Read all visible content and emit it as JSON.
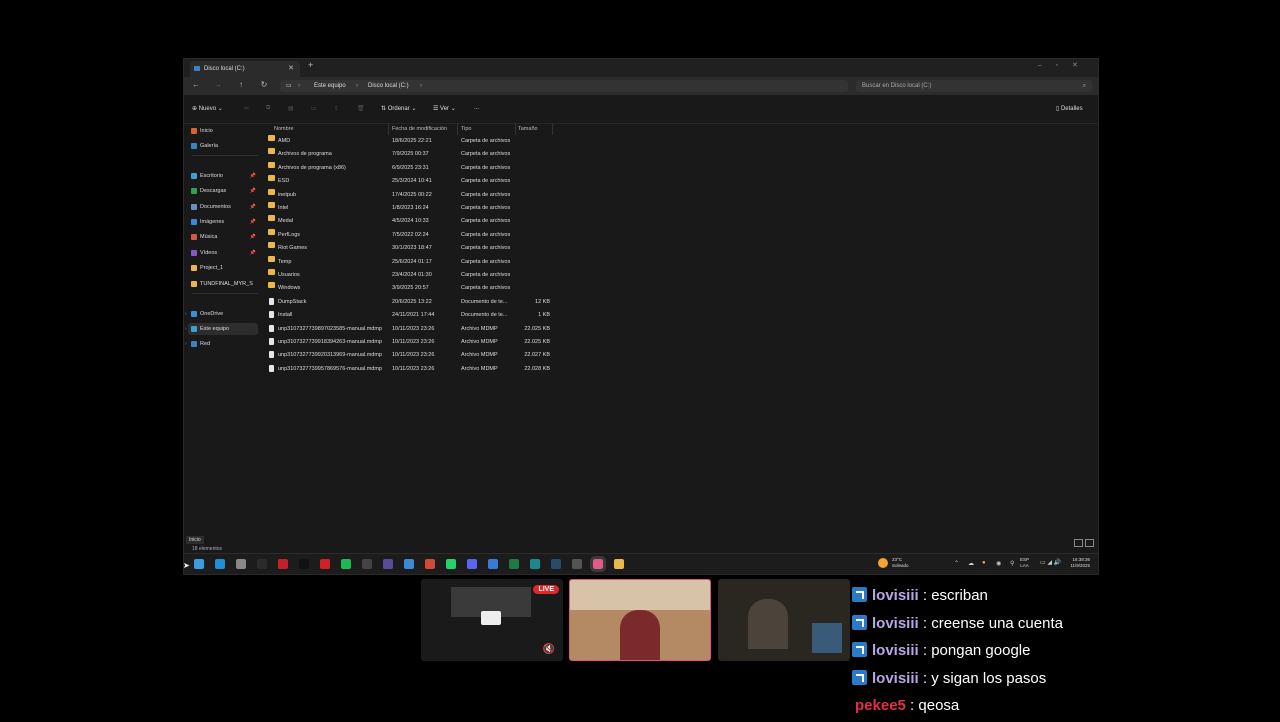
{
  "explorer": {
    "tab_title": "Disco local (C:)",
    "breadcrumb": [
      "Este equipo",
      "Disco local (C:)"
    ],
    "search_placeholder": "Buscar en Disco local (C:)",
    "commands": {
      "new": "Nuevo",
      "sort": "Ordenar",
      "view": "Ver",
      "more": "...",
      "details": "Detalles"
    },
    "sidebar": [
      {
        "label": "Inicio",
        "icon": "home-icon",
        "color": "#d9632a"
      },
      {
        "label": "Galería",
        "icon": "gallery-icon",
        "color": "#3b82c4"
      },
      {
        "label": "Escritorio",
        "icon": "desktop-icon",
        "color": "#3aa0d8",
        "pinned": true
      },
      {
        "label": "Descargas",
        "icon": "download-icon",
        "color": "#2f9e5a",
        "pinned": true
      },
      {
        "label": "Documentos",
        "icon": "documents-icon",
        "color": "#6a8fbf",
        "pinned": true
      },
      {
        "label": "Imágenes",
        "icon": "pictures-icon",
        "color": "#3a8ad6",
        "pinned": true
      },
      {
        "label": "Música",
        "icon": "music-icon",
        "color": "#d05a4a",
        "pinned": true
      },
      {
        "label": "Vídeos",
        "icon": "videos-icon",
        "color": "#8a55c9",
        "pinned": true
      },
      {
        "label": "Project_1",
        "icon": "folder-icon",
        "color": "#e8b94a"
      },
      {
        "label": "TUNDFINAL_MYR_S",
        "icon": "folder-icon",
        "color": "#e8b94a"
      },
      {
        "label": "OneDrive",
        "icon": "onedrive-icon",
        "color": "#3b8fd9"
      },
      {
        "label": "Este equipo",
        "icon": "pc-icon",
        "color": "#3aa0d8",
        "selected": true
      },
      {
        "label": "Red",
        "icon": "network-icon",
        "color": "#3b82c4"
      }
    ],
    "columns": [
      "Nombre",
      "Fecha de modificación",
      "Tipo",
      "Tamaño"
    ],
    "files": [
      {
        "name": "AMD",
        "date": "18/6/2025 22:21",
        "type": "Carpeta de archivos",
        "size": "",
        "kind": "folder"
      },
      {
        "name": "Archivos de programa",
        "date": "7/9/2025 00:37",
        "type": "Carpeta de archivos",
        "size": "",
        "kind": "folder"
      },
      {
        "name": "Archivos de programa (x86)",
        "date": "6/9/2025 23:31",
        "type": "Carpeta de archivos",
        "size": "",
        "kind": "folder"
      },
      {
        "name": "ESD",
        "date": "25/3/2024 10:41",
        "type": "Carpeta de archivos",
        "size": "",
        "kind": "folder"
      },
      {
        "name": "inetpub",
        "date": "17/4/2025 00:22",
        "type": "Carpeta de archivos",
        "size": "",
        "kind": "folder"
      },
      {
        "name": "Intel",
        "date": "1/8/2023 16:24",
        "type": "Carpeta de archivos",
        "size": "",
        "kind": "folder"
      },
      {
        "name": "Medal",
        "date": "4/5/2024 10:33",
        "type": "Carpeta de archivos",
        "size": "",
        "kind": "folder"
      },
      {
        "name": "PerfLogs",
        "date": "7/5/2022 02:24",
        "type": "Carpeta de archivos",
        "size": "",
        "kind": "folder"
      },
      {
        "name": "Riot Games",
        "date": "30/1/2023 18:47",
        "type": "Carpeta de archivos",
        "size": "",
        "kind": "folder"
      },
      {
        "name": "Temp",
        "date": "25/6/2024 01:17",
        "type": "Carpeta de archivos",
        "size": "",
        "kind": "folder"
      },
      {
        "name": "Usuarios",
        "date": "23/4/2024 01:30",
        "type": "Carpeta de archivos",
        "size": "",
        "kind": "folder"
      },
      {
        "name": "Windows",
        "date": "3/9/2025 20:57",
        "type": "Carpeta de archivos",
        "size": "",
        "kind": "folder"
      },
      {
        "name": "DumpStack",
        "date": "20/6/2025 13:22",
        "type": "Documento de te...",
        "size": "12 KB",
        "kind": "file"
      },
      {
        "name": "Install",
        "date": "24/11/2021 17:44",
        "type": "Documento de te...",
        "size": "1 KB",
        "kind": "file"
      },
      {
        "name": "unp3107327739897023585-manual.mdmp",
        "date": "10/11/2023 23:26",
        "type": "Archivo MDMP",
        "size": "22.025 KB",
        "kind": "file"
      },
      {
        "name": "unp3107327739918394263-manual.mdmp",
        "date": "10/11/2023 23:26",
        "type": "Archivo MDMP",
        "size": "22.025 KB",
        "kind": "file"
      },
      {
        "name": "unp3107327739920313969-manual.mdmp",
        "date": "10/11/2023 23:26",
        "type": "Archivo MDMP",
        "size": "22.027 KB",
        "kind": "file"
      },
      {
        "name": "unp3107327739957869576-manual.mdmp",
        "date": "10/11/2023 23:26",
        "type": "Archivo MDMP",
        "size": "22.028 KB",
        "kind": "file"
      }
    ],
    "status_text": "18 elementos",
    "start_tooltip": "Inicio"
  },
  "taskbar": {
    "weather_temp": "23°C",
    "weather_desc": "Soleado",
    "lang_top": "ESP",
    "lang_bottom": "LAA",
    "time": "16:38:36",
    "date": "11/9/2025",
    "icons": [
      {
        "name": "start-icon",
        "color": "#3a9be0"
      },
      {
        "name": "edge-icon",
        "color": "#1f8fd6"
      },
      {
        "name": "settings-icon",
        "color": "#888888"
      },
      {
        "name": "terminal-icon",
        "color": "#2b2b2b"
      },
      {
        "name": "app-red-icon",
        "color": "#c4202a"
      },
      {
        "name": "tiktok-icon",
        "color": "#111111"
      },
      {
        "name": "opera-icon",
        "color": "#d0202a"
      },
      {
        "name": "spotify-icon",
        "color": "#1db954"
      },
      {
        "name": "obs-icon",
        "color": "#444444"
      },
      {
        "name": "wix-icon",
        "color": "#5a4a9a"
      },
      {
        "name": "app-blue-icon",
        "color": "#3a8ad6"
      },
      {
        "name": "chrome-icon",
        "color": "#d04a3a"
      },
      {
        "name": "whatsapp-icon",
        "color": "#25d366"
      },
      {
        "name": "discord-icon",
        "color": "#5865f2"
      },
      {
        "name": "app-blue2-icon",
        "color": "#3a7ad6"
      },
      {
        "name": "excel-icon",
        "color": "#1d7a44"
      },
      {
        "name": "app-teal-icon",
        "color": "#1a8a8a"
      },
      {
        "name": "steam-icon",
        "color": "#2a4a6a"
      },
      {
        "name": "app-dark-icon",
        "color": "#555555"
      },
      {
        "name": "app-pink-icon",
        "color": "#e05a8a"
      },
      {
        "name": "file-explorer-icon",
        "color": "#e8b94a"
      }
    ]
  },
  "stream": {
    "live_label": "LIVE",
    "chat": [
      {
        "user": "lovisiii",
        "text": "escriban",
        "color": "#b9a6e6",
        "badge": true
      },
      {
        "user": "lovisiii",
        "text": "creense una cuenta",
        "color": "#b9a6e6",
        "badge": true
      },
      {
        "user": "lovisiii",
        "text": "pongan google",
        "color": "#b9a6e6",
        "badge": true
      },
      {
        "user": "lovisiii",
        "text": "y sigan los pasos",
        "color": "#b9a6e6",
        "badge": true
      },
      {
        "user": "pekee5",
        "text": "qeosa",
        "color": "#e0304a",
        "badge": false
      }
    ]
  }
}
